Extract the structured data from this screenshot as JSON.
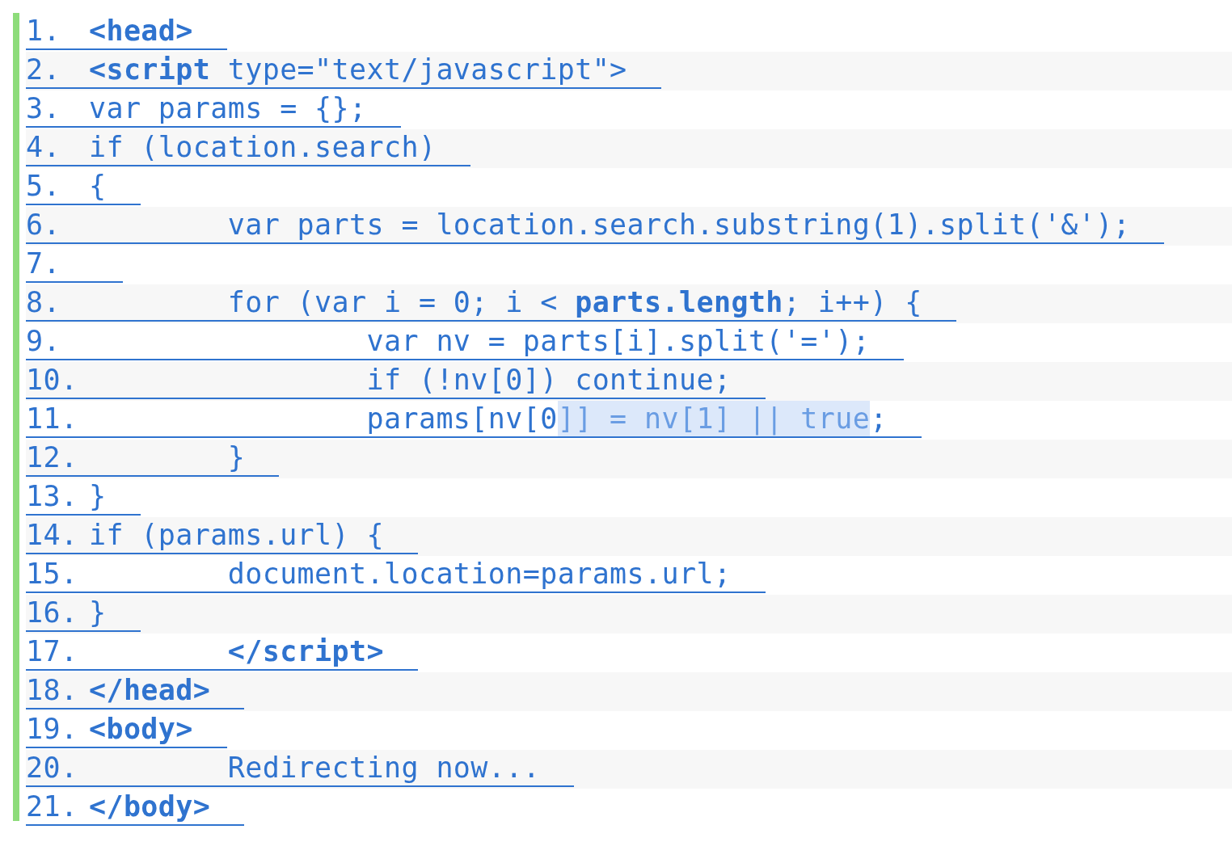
{
  "lines": [
    {
      "number": "1.",
      "code": "**<head>**"
    },
    {
      "number": "2.",
      "code": "**<script** type=\"text/javascript\">"
    },
    {
      "number": "3.",
      "code": "var params = {};"
    },
    {
      "number": "4.",
      "code": "if (location.search)"
    },
    {
      "number": "5.",
      "code": "{"
    },
    {
      "number": "6.",
      "code": "        var parts = location.search.substring(1).split('&');"
    },
    {
      "number": "7."
    },
    {
      "number": "8.",
      "code": "        for (var i = 0; i < **parts.length**; i++) {"
    },
    {
      "number": "9.",
      "code": "                var nv = parts[i].split('=');"
    },
    {
      "number": "10.",
      "code": "                if (!nv[0]) continue;"
    },
    {
      "number": "11.",
      "code": "                params[nv[0",
      "selected_text": "]] = nv[1] || true",
      "code_after": ";"
    },
    {
      "number": "12.",
      "code": "        }"
    },
    {
      "number": "13.",
      "code": "}"
    },
    {
      "number": "14.",
      "code": "if (params.url) {"
    },
    {
      "number": "15.",
      "code": "        document.location=params.url;"
    },
    {
      "number": "16.",
      "code": "}"
    },
    {
      "number": "17.",
      "code": "        **</script>**"
    },
    {
      "number": "18.",
      "code": "**</head>**"
    },
    {
      "number": "19.",
      "code": "**<body>**"
    },
    {
      "number": "20.",
      "code": "        Redirecting now..."
    },
    {
      "number": "21.",
      "code": "**</body>**"
    }
  ]
}
